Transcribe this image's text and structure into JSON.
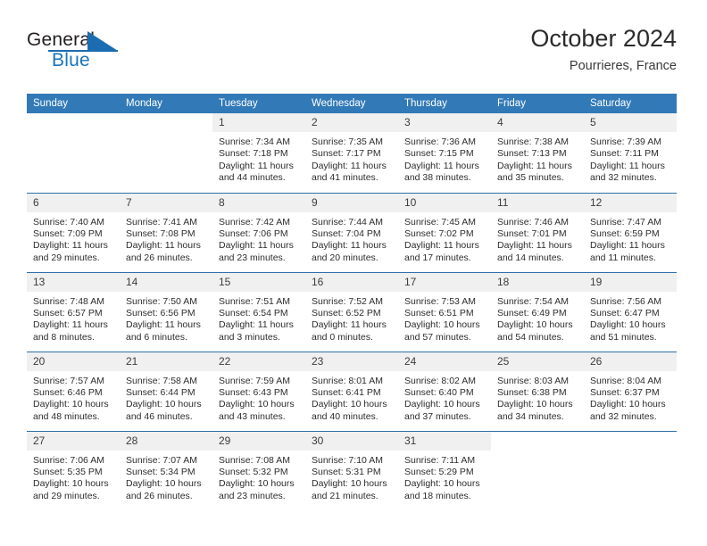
{
  "brand": {
    "name_top": "General",
    "name_bottom": "Blue",
    "accent_color": "#1b6cb0"
  },
  "header": {
    "title": "October 2024",
    "subtitle": "Pourrieres, France"
  },
  "calendar": {
    "header_color": "#3279b7",
    "weekday_headers": [
      "Sunday",
      "Monday",
      "Tuesday",
      "Wednesday",
      "Thursday",
      "Friday",
      "Saturday"
    ],
    "labels": {
      "sunrise": "Sunrise:",
      "sunset": "Sunset:",
      "daylight": "Daylight:"
    },
    "weeks": [
      [
        {
          "day": "",
          "empty": true
        },
        {
          "day": "",
          "empty": true
        },
        {
          "day": "1",
          "sunrise": "Sunrise: 7:34 AM",
          "sunset": "Sunset: 7:18 PM",
          "daylight_1": "Daylight: 11 hours",
          "daylight_2": "and 44 minutes."
        },
        {
          "day": "2",
          "sunrise": "Sunrise: 7:35 AM",
          "sunset": "Sunset: 7:17 PM",
          "daylight_1": "Daylight: 11 hours",
          "daylight_2": "and 41 minutes."
        },
        {
          "day": "3",
          "sunrise": "Sunrise: 7:36 AM",
          "sunset": "Sunset: 7:15 PM",
          "daylight_1": "Daylight: 11 hours",
          "daylight_2": "and 38 minutes."
        },
        {
          "day": "4",
          "sunrise": "Sunrise: 7:38 AM",
          "sunset": "Sunset: 7:13 PM",
          "daylight_1": "Daylight: 11 hours",
          "daylight_2": "and 35 minutes."
        },
        {
          "day": "5",
          "sunrise": "Sunrise: 7:39 AM",
          "sunset": "Sunset: 7:11 PM",
          "daylight_1": "Daylight: 11 hours",
          "daylight_2": "and 32 minutes."
        }
      ],
      [
        {
          "day": "6",
          "sunrise": "Sunrise: 7:40 AM",
          "sunset": "Sunset: 7:09 PM",
          "daylight_1": "Daylight: 11 hours",
          "daylight_2": "and 29 minutes."
        },
        {
          "day": "7",
          "sunrise": "Sunrise: 7:41 AM",
          "sunset": "Sunset: 7:08 PM",
          "daylight_1": "Daylight: 11 hours",
          "daylight_2": "and 26 minutes."
        },
        {
          "day": "8",
          "sunrise": "Sunrise: 7:42 AM",
          "sunset": "Sunset: 7:06 PM",
          "daylight_1": "Daylight: 11 hours",
          "daylight_2": "and 23 minutes."
        },
        {
          "day": "9",
          "sunrise": "Sunrise: 7:44 AM",
          "sunset": "Sunset: 7:04 PM",
          "daylight_1": "Daylight: 11 hours",
          "daylight_2": "and 20 minutes."
        },
        {
          "day": "10",
          "sunrise": "Sunrise: 7:45 AM",
          "sunset": "Sunset: 7:02 PM",
          "daylight_1": "Daylight: 11 hours",
          "daylight_2": "and 17 minutes."
        },
        {
          "day": "11",
          "sunrise": "Sunrise: 7:46 AM",
          "sunset": "Sunset: 7:01 PM",
          "daylight_1": "Daylight: 11 hours",
          "daylight_2": "and 14 minutes."
        },
        {
          "day": "12",
          "sunrise": "Sunrise: 7:47 AM",
          "sunset": "Sunset: 6:59 PM",
          "daylight_1": "Daylight: 11 hours",
          "daylight_2": "and 11 minutes."
        }
      ],
      [
        {
          "day": "13",
          "sunrise": "Sunrise: 7:48 AM",
          "sunset": "Sunset: 6:57 PM",
          "daylight_1": "Daylight: 11 hours",
          "daylight_2": "and 8 minutes."
        },
        {
          "day": "14",
          "sunrise": "Sunrise: 7:50 AM",
          "sunset": "Sunset: 6:56 PM",
          "daylight_1": "Daylight: 11 hours",
          "daylight_2": "and 6 minutes."
        },
        {
          "day": "15",
          "sunrise": "Sunrise: 7:51 AM",
          "sunset": "Sunset: 6:54 PM",
          "daylight_1": "Daylight: 11 hours",
          "daylight_2": "and 3 minutes."
        },
        {
          "day": "16",
          "sunrise": "Sunrise: 7:52 AM",
          "sunset": "Sunset: 6:52 PM",
          "daylight_1": "Daylight: 11 hours",
          "daylight_2": "and 0 minutes."
        },
        {
          "day": "17",
          "sunrise": "Sunrise: 7:53 AM",
          "sunset": "Sunset: 6:51 PM",
          "daylight_1": "Daylight: 10 hours",
          "daylight_2": "and 57 minutes."
        },
        {
          "day": "18",
          "sunrise": "Sunrise: 7:54 AM",
          "sunset": "Sunset: 6:49 PM",
          "daylight_1": "Daylight: 10 hours",
          "daylight_2": "and 54 minutes."
        },
        {
          "day": "19",
          "sunrise": "Sunrise: 7:56 AM",
          "sunset": "Sunset: 6:47 PM",
          "daylight_1": "Daylight: 10 hours",
          "daylight_2": "and 51 minutes."
        }
      ],
      [
        {
          "day": "20",
          "sunrise": "Sunrise: 7:57 AM",
          "sunset": "Sunset: 6:46 PM",
          "daylight_1": "Daylight: 10 hours",
          "daylight_2": "and 48 minutes."
        },
        {
          "day": "21",
          "sunrise": "Sunrise: 7:58 AM",
          "sunset": "Sunset: 6:44 PM",
          "daylight_1": "Daylight: 10 hours",
          "daylight_2": "and 46 minutes."
        },
        {
          "day": "22",
          "sunrise": "Sunrise: 7:59 AM",
          "sunset": "Sunset: 6:43 PM",
          "daylight_1": "Daylight: 10 hours",
          "daylight_2": "and 43 minutes."
        },
        {
          "day": "23",
          "sunrise": "Sunrise: 8:01 AM",
          "sunset": "Sunset: 6:41 PM",
          "daylight_1": "Daylight: 10 hours",
          "daylight_2": "and 40 minutes."
        },
        {
          "day": "24",
          "sunrise": "Sunrise: 8:02 AM",
          "sunset": "Sunset: 6:40 PM",
          "daylight_1": "Daylight: 10 hours",
          "daylight_2": "and 37 minutes."
        },
        {
          "day": "25",
          "sunrise": "Sunrise: 8:03 AM",
          "sunset": "Sunset: 6:38 PM",
          "daylight_1": "Daylight: 10 hours",
          "daylight_2": "and 34 minutes."
        },
        {
          "day": "26",
          "sunrise": "Sunrise: 8:04 AM",
          "sunset": "Sunset: 6:37 PM",
          "daylight_1": "Daylight: 10 hours",
          "daylight_2": "and 32 minutes."
        }
      ],
      [
        {
          "day": "27",
          "sunrise": "Sunrise: 7:06 AM",
          "sunset": "Sunset: 5:35 PM",
          "daylight_1": "Daylight: 10 hours",
          "daylight_2": "and 29 minutes."
        },
        {
          "day": "28",
          "sunrise": "Sunrise: 7:07 AM",
          "sunset": "Sunset: 5:34 PM",
          "daylight_1": "Daylight: 10 hours",
          "daylight_2": "and 26 minutes."
        },
        {
          "day": "29",
          "sunrise": "Sunrise: 7:08 AM",
          "sunset": "Sunset: 5:32 PM",
          "daylight_1": "Daylight: 10 hours",
          "daylight_2": "and 23 minutes."
        },
        {
          "day": "30",
          "sunrise": "Sunrise: 7:10 AM",
          "sunset": "Sunset: 5:31 PM",
          "daylight_1": "Daylight: 10 hours",
          "daylight_2": "and 21 minutes."
        },
        {
          "day": "31",
          "sunrise": "Sunrise: 7:11 AM",
          "sunset": "Sunset: 5:29 PM",
          "daylight_1": "Daylight: 10 hours",
          "daylight_2": "and 18 minutes."
        },
        {
          "day": "",
          "empty": true
        },
        {
          "day": "",
          "empty": true
        }
      ]
    ]
  }
}
